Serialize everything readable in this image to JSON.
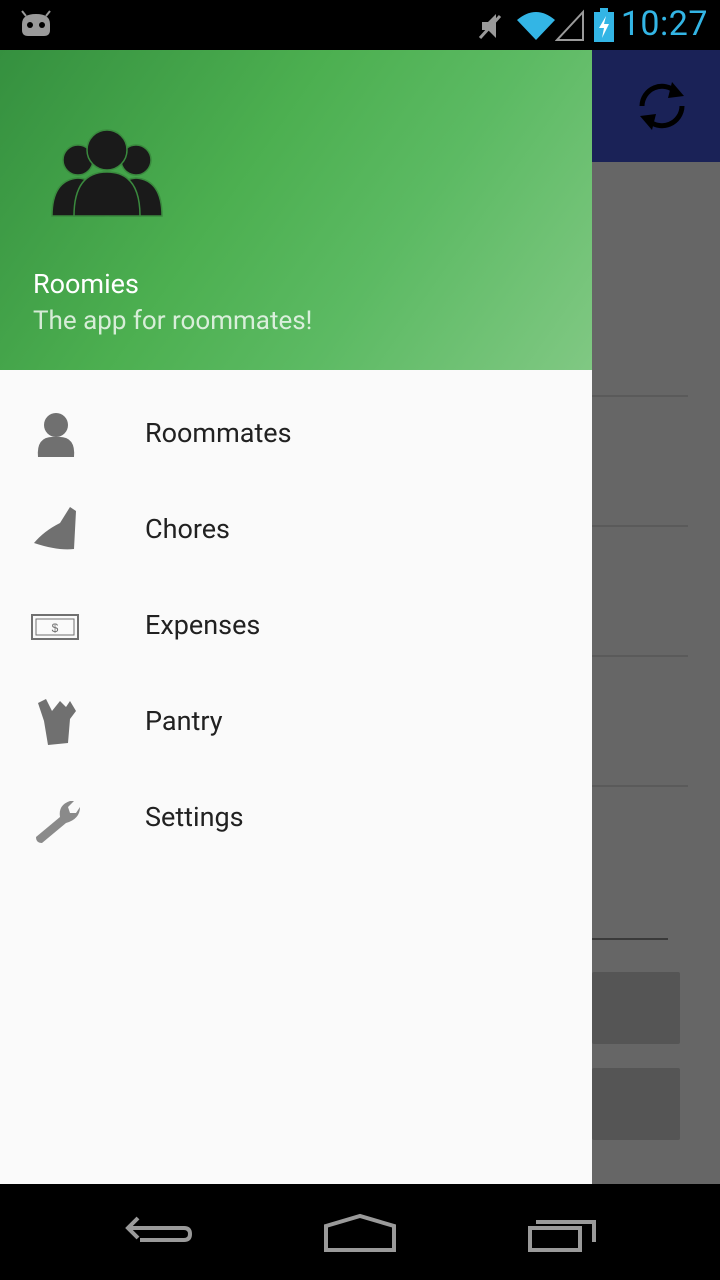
{
  "status_bar": {
    "time": "10:27"
  },
  "drawer": {
    "header": {
      "title": "Roomies",
      "subtitle": "The app for roommates!"
    },
    "items": [
      {
        "label": "Roommates",
        "icon": "person-icon"
      },
      {
        "label": "Chores",
        "icon": "broom-icon"
      },
      {
        "label": "Expenses",
        "icon": "money-bill-icon"
      },
      {
        "label": "Pantry",
        "icon": "grocery-bag-icon"
      },
      {
        "label": "Settings",
        "icon": "wrench-icon"
      }
    ]
  },
  "colors": {
    "header_gradient": [
      "#35903f",
      "#4caf50",
      "#80c883"
    ],
    "action_bar": "#1a2257",
    "status_accent": "#33b5e5"
  }
}
